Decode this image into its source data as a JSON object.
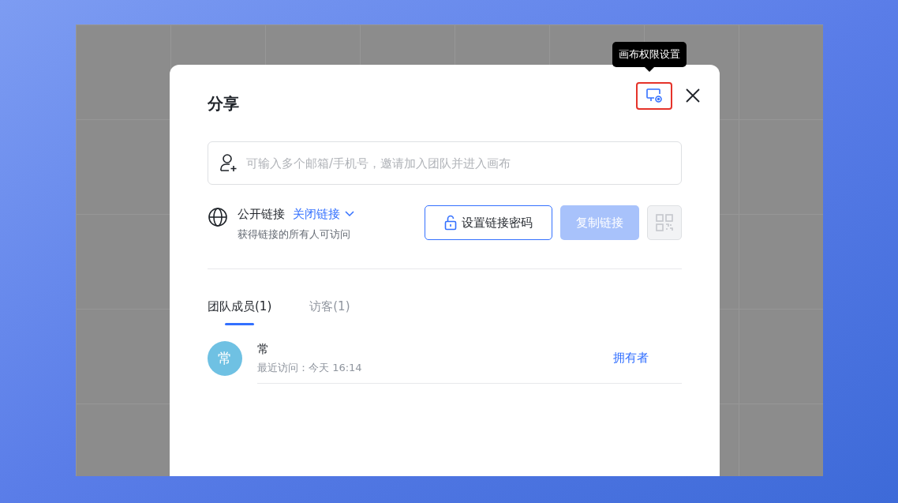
{
  "tooltip": "画布权限设置",
  "dialog": {
    "title": "分享",
    "invite_field": {
      "placeholder": "可输入多个邮箱/手机号，邀请加入团队并进入画布"
    },
    "public_link": {
      "label": "公开链接",
      "dropdown": "关闭链接",
      "description": "获得链接的所有人可访问"
    },
    "buttons": [
      {
        "kind": "outline",
        "label": "设置链接密码",
        "disabled": false
      },
      {
        "kind": "primary",
        "label": "复制链接",
        "disabled": true
      },
      {
        "kind": "qr",
        "disabled": true
      }
    ],
    "tabs": [
      {
        "label": "团队成员(1)",
        "selected": true
      },
      {
        "label": "访客(1)",
        "selected": false
      }
    ],
    "members": [
      {
        "avatar": "常",
        "name": "常",
        "last_visit": "最近访问：今天 16:14",
        "role": "拥有者"
      }
    ]
  }
}
